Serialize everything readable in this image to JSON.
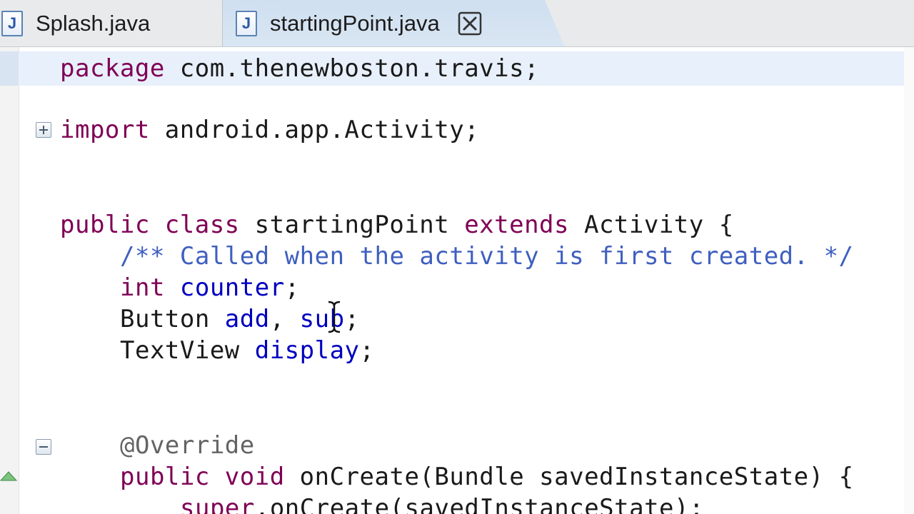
{
  "tabs": [
    {
      "label": "Splash.java",
      "icon": "java-file-icon",
      "active": false
    },
    {
      "label": "startingPoint.java",
      "icon": "java-file-icon",
      "active": true,
      "closable": true
    }
  ],
  "colors": {
    "keyword": "#7f0055",
    "field": "#0000c0",
    "javadoc": "#3f5fbf",
    "annotation": "#646464",
    "active_tab": "#d4e3f2",
    "current_line": "#e8f0fb"
  },
  "code": {
    "l1": {
      "kw": "package",
      "rest": " com.thenewboston.travis;"
    },
    "l2": {
      "kw": "import",
      "rest": " android.app.Activity;"
    },
    "l3": {
      "kw1": "public",
      "kw2": " class",
      "name": " startingPoint",
      "kw3": " extends",
      "rest": " Activity {"
    },
    "l4": {
      "doc": "/** Called when the activity is first created. */"
    },
    "l5": {
      "kw": "int",
      "field": " counter",
      "rest": ";"
    },
    "l6": {
      "type": "Button",
      "f1": " add",
      "sep": ",",
      "f2": " sub",
      "rest": ";"
    },
    "l7": {
      "type": "TextView",
      "field": " display",
      "rest": ";"
    },
    "l8": {
      "ann": "@Override"
    },
    "l9": {
      "kw1": "public",
      "kw2": " void",
      "rest": " onCreate(Bundle savedInstanceState) {"
    },
    "l10": {
      "kw": "super",
      "rest": ".onCreate(savedInstanceState);"
    }
  }
}
